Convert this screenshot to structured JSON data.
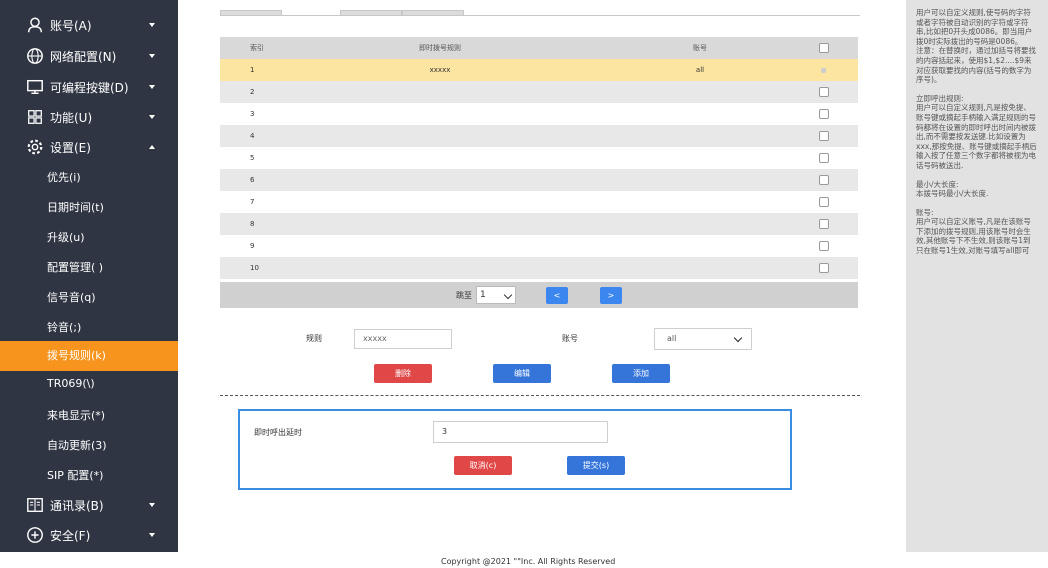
{
  "sidebar": {
    "menus": [
      {
        "label": "账号(A)",
        "icon": "user-icon"
      },
      {
        "label": "网络配置(N)",
        "icon": "globe-icon"
      },
      {
        "label": "可编程按键(D)",
        "icon": "monitor-icon"
      },
      {
        "label": "功能(U)",
        "icon": "grid-icon"
      },
      {
        "label": "设置(E)",
        "icon": "gear-icon"
      },
      {
        "label": "通讯录(B)",
        "icon": "book-icon"
      },
      {
        "label": "安全(F)",
        "icon": "shield-plus-icon"
      }
    ],
    "settings_sub": [
      {
        "label": "优先(i)"
      },
      {
        "label": "日期时间(t)"
      },
      {
        "label": "升级(u)"
      },
      {
        "label": "配置管理( )"
      },
      {
        "label": "信号音(q)"
      },
      {
        "label": "铃音(;)"
      },
      {
        "label": "拨号规则(k)",
        "active": true
      },
      {
        "label": "TR069(\\)"
      },
      {
        "label": "来电显示(*)"
      },
      {
        "label": "自动更新(3)"
      },
      {
        "label": "SIP 配置(*)"
      }
    ],
    "colors": {
      "background": "#2f3542",
      "active": "#f7941d"
    }
  },
  "rules_table": {
    "headers": {
      "index": "索引",
      "rule": "即时拨号规则",
      "account": "账号"
    },
    "rows": [
      {
        "index": "1",
        "rule": "xxxxx",
        "account": "all",
        "selected": true
      },
      {
        "index": "2",
        "rule": "",
        "account": ""
      },
      {
        "index": "3",
        "rule": "",
        "account": ""
      },
      {
        "index": "4",
        "rule": "",
        "account": ""
      },
      {
        "index": "5",
        "rule": "",
        "account": ""
      },
      {
        "index": "6",
        "rule": "",
        "account": ""
      },
      {
        "index": "7",
        "rule": "",
        "account": ""
      },
      {
        "index": "8",
        "rule": "",
        "account": ""
      },
      {
        "index": "9",
        "rule": "",
        "account": ""
      },
      {
        "index": "10",
        "rule": "",
        "account": ""
      }
    ],
    "pager": {
      "label": "跳至",
      "page": "1",
      "prev": "<",
      "next": ">"
    }
  },
  "rule_form": {
    "rule_label": "规则",
    "rule_value": "xxxxx",
    "account_label": "账号",
    "account_value": "all",
    "delete_button": "删除",
    "edit_button": "编辑",
    "add_button": "添加"
  },
  "timeout_form": {
    "label": "即时呼出延时",
    "value": "3",
    "cancel_button": "取消(c)",
    "submit_button": "提交(s)"
  },
  "help": {
    "paragraphs": [
      "用户可以自定义规则,使号码的字符或者字符被自动识别的字符或字符串,比如把0开头成0086。即当用户拨0时实际拨出的号码是0086。",
      "注意：在替换时，通过加括号将要找的内容括起来，使用$1,$2....$9来对应获取要找的内容(括号的数字为序号)。"
    ],
    "sections": [
      {
        "title": "立即呼出规则:",
        "body": "用户可以自定义规则,凡是按免提、账号键或摘起手柄输入满足规则的号码都将在设置的即时呼出时间内被拨出,而不需要按发送键.比如设置为xxx,那按免提、账号键或摘起手柄后输入按了任意三个数字都将被视为电话号码被送出."
      },
      {
        "title": "最小/大长度:",
        "body": "本拨号码最小/大长度."
      },
      {
        "title": "账号:",
        "body": "用户可以自定义账号,凡是在该账号下添加的拨号规则,用该账号时会生效,其他账号下不生效,则该账号1到只在账号1生效,对账号填写all即可"
      }
    ]
  },
  "footer": {
    "text": "Copyright @2021 \"\"Inc. All Rights Reserved"
  }
}
